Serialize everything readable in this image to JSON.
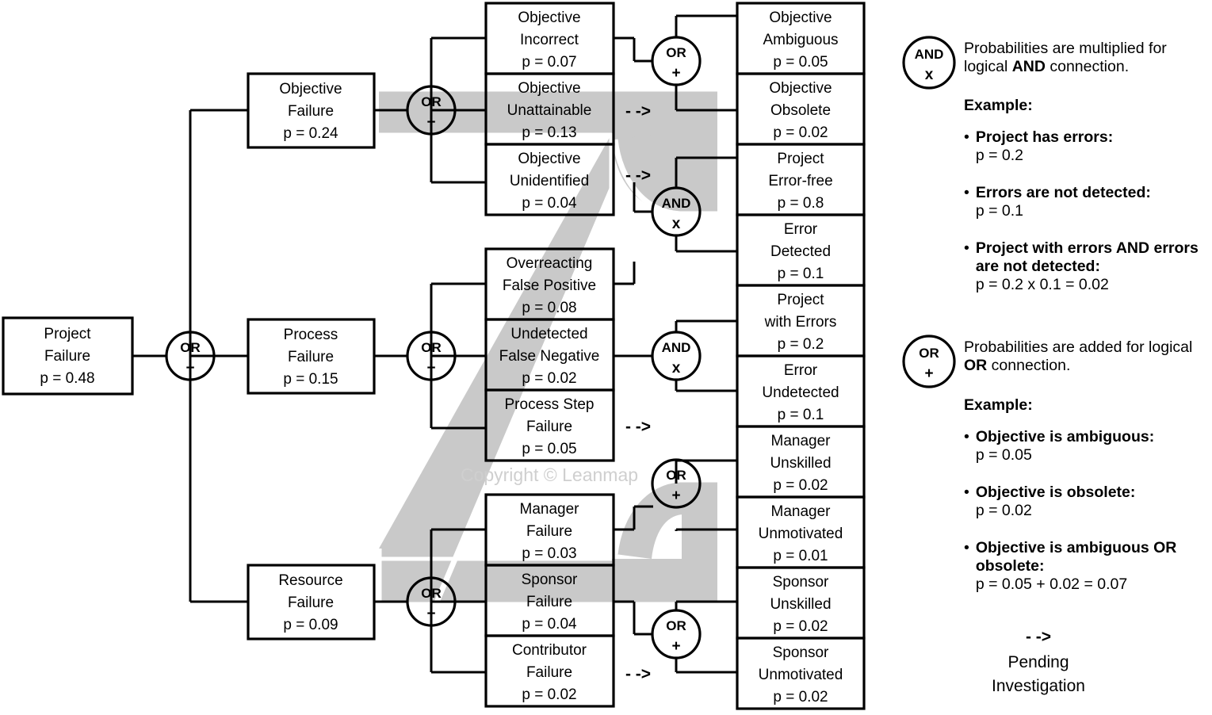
{
  "diagram": {
    "title": "Project Failure Fault Tree",
    "watermark": "Copyright © Leanmap",
    "colors": {
      "line": "#000000",
      "highlight": "#c9c9c9",
      "watermark": "#cfcfcf",
      "background": "#ffffff"
    }
  },
  "root": {
    "name_line1": "Project",
    "name_line2": "Failure",
    "p": "p = 0.48"
  },
  "level1": [
    {
      "name_line1": "Objective",
      "name_line2": "Failure",
      "p": "p = 0.24"
    },
    {
      "name_line1": "Process",
      "name_line2": "Failure",
      "p": "p = 0.15"
    },
    {
      "name_line1": "Resource",
      "name_line2": "Failure",
      "p": "p = 0.09"
    }
  ],
  "level2": [
    {
      "name_line1": "Objective",
      "name_line2": "Incorrect",
      "p": "p = 0.07",
      "pending": false
    },
    {
      "name_line1": "Objective",
      "name_line2": "Unattainable",
      "p": "p = 0.13",
      "pending": true
    },
    {
      "name_line1": "Objective",
      "name_line2": "Unidentified",
      "p": "p = 0.04",
      "pending": true
    },
    {
      "name_line1": "Overreacting",
      "name_line2": "False Positive",
      "p": "p = 0.08",
      "pending": false
    },
    {
      "name_line1": "Undetected",
      "name_line2": "False Negative",
      "p": "p = 0.02",
      "pending": false
    },
    {
      "name_line1": "Process Step",
      "name_line2": "Failure",
      "p": "p = 0.05",
      "pending": true
    },
    {
      "name_line1": "Manager",
      "name_line2": "Failure",
      "p": "p = 0.03",
      "pending": false
    },
    {
      "name_line1": "Sponsor",
      "name_line2": "Failure",
      "p": "p = 0.04",
      "pending": false
    },
    {
      "name_line1": "Contributor",
      "name_line2": "Failure",
      "p": "p = 0.02",
      "pending": true
    }
  ],
  "level3": [
    {
      "name_line1": "Objective",
      "name_line2": "Ambiguous",
      "p": "p = 0.05"
    },
    {
      "name_line1": "Objective",
      "name_line2": "Obsolete",
      "p": "p = 0.02"
    },
    {
      "name_line1": "Project",
      "name_line2": "Error-free",
      "p": "p = 0.8"
    },
    {
      "name_line1": "Error",
      "name_line2": "Detected",
      "p": "p = 0.1"
    },
    {
      "name_line1": "Project",
      "name_line2": "with Errors",
      "p": "p = 0.2"
    },
    {
      "name_line1": "Error",
      "name_line2": "Undetected",
      "p": "p = 0.1"
    },
    {
      "name_line1": "Manager",
      "name_line2": "Unskilled",
      "p": "p = 0.02"
    },
    {
      "name_line1": "Manager",
      "name_line2": "Unmotivated",
      "p": "p = 0.01"
    },
    {
      "name_line1": "Sponsor",
      "name_line2": "Unskilled",
      "p": "p = 0.02"
    },
    {
      "name_line1": "Sponsor",
      "name_line2": "Unmotivated",
      "p": "p = 0.02"
    }
  ],
  "gates": [
    {
      "id": "gate-root",
      "type": "OR",
      "symbol": "+"
    },
    {
      "id": "gate-objective",
      "type": "OR",
      "symbol": "+"
    },
    {
      "id": "gate-process",
      "type": "OR",
      "symbol": "+"
    },
    {
      "id": "gate-resource",
      "type": "OR",
      "symbol": "+"
    },
    {
      "id": "gate-objective-incorrect",
      "type": "OR",
      "symbol": "+"
    },
    {
      "id": "gate-objective-unidentified",
      "type": "AND",
      "symbol": "x"
    },
    {
      "id": "gate-false-negative",
      "type": "AND",
      "symbol": "x"
    },
    {
      "id": "gate-manager",
      "type": "OR",
      "symbol": "+"
    },
    {
      "id": "gate-sponsor",
      "type": "OR",
      "symbol": "+"
    }
  ],
  "pending_marker": "- ->",
  "legend": {
    "and": {
      "gate_label": "AND",
      "gate_symbol": "x",
      "desc_pre": "Probabilities are multiplied for logical ",
      "desc_bold": "AND",
      "desc_post": " connection.",
      "example_label": "Example:",
      "bullets": [
        {
          "text": "Project has errors:",
          "value": "p = 0.2"
        },
        {
          "text": "Errors are not detected:",
          "value": "p = 0.1"
        },
        {
          "text_pre": "Project with errors ",
          "text_bold": "AND",
          "text_post": " errors are not detected:",
          "value": "p = 0.2 x 0.1 = 0.02"
        }
      ]
    },
    "or": {
      "gate_label": "OR",
      "gate_symbol": "+",
      "desc_pre": "Probabilities are added for logical ",
      "desc_bold": "OR",
      "desc_post": " connection.",
      "example_label": "Example:",
      "bullets": [
        {
          "text": "Objective is ambiguous:",
          "value": "p = 0.05"
        },
        {
          "text": "Objective is obsolete:",
          "value": "p = 0.02"
        },
        {
          "text_pre": "Objective is ambiguous ",
          "text_bold": "OR",
          "text_post": " obsolete:",
          "value": "p = 0.05 + 0.02 = 0.07"
        }
      ]
    },
    "pending": {
      "marker": "- ->",
      "line1": "Pending",
      "line2": "Investigation"
    }
  }
}
